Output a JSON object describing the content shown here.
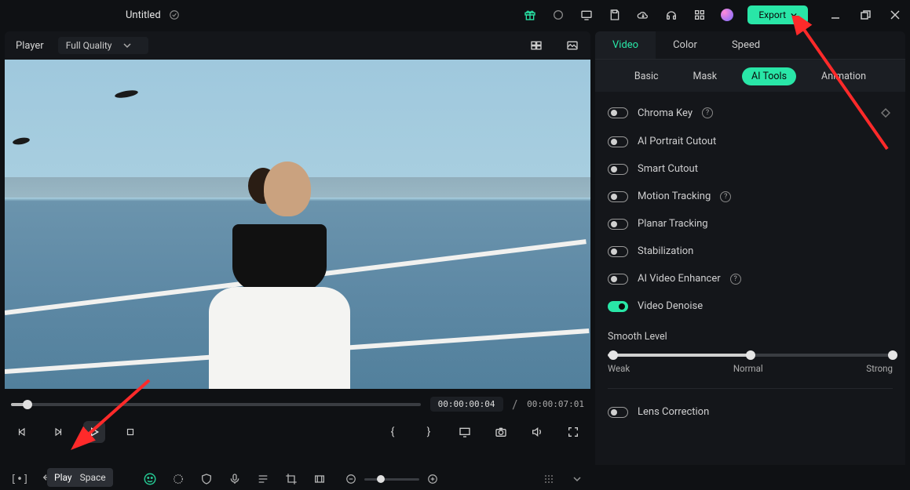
{
  "titlebar": {
    "document_name": "Untitled",
    "export_label": "Export"
  },
  "player": {
    "label": "Player",
    "quality": "Full Quality",
    "current_time": "00:00:00:04",
    "separator": "/",
    "total_time": "00:00:07:01",
    "tooltip_action": "Play",
    "tooltip_key": "Space"
  },
  "panel": {
    "tabs": {
      "video": "Video",
      "color": "Color",
      "speed": "Speed"
    },
    "subtabs": {
      "basic": "Basic",
      "mask": "Mask",
      "ai_tools": "AI Tools",
      "animation": "Animation"
    },
    "toggles": {
      "chroma_key": "Chroma Key",
      "ai_portrait": "AI Portrait Cutout",
      "smart_cutout": "Smart Cutout",
      "motion_tracking": "Motion Tracking",
      "planar_tracking": "Planar Tracking",
      "stabilization": "Stabilization",
      "ai_video_enhancer": "AI Video Enhancer",
      "video_denoise": "Video Denoise",
      "lens_correction": "Lens Correction"
    },
    "slider": {
      "label": "Smooth Level",
      "weak": "Weak",
      "normal": "Normal",
      "strong": "Strong",
      "value_pct": 50
    }
  }
}
